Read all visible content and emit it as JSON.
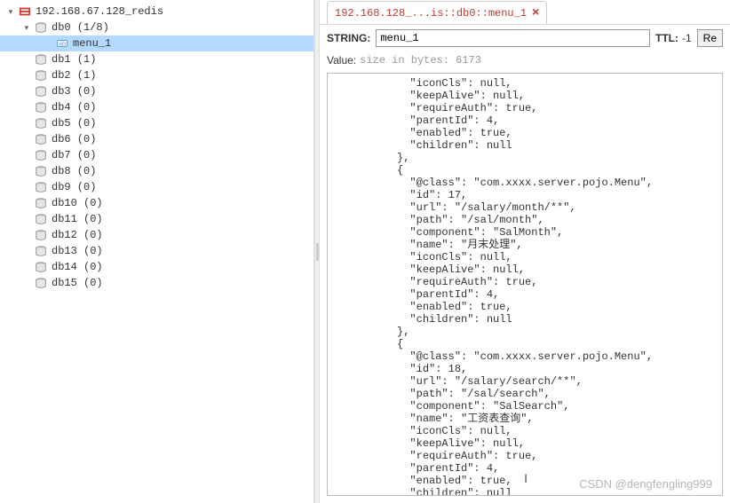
{
  "sidebar": {
    "root": {
      "label": "192.168.67.128_redis"
    },
    "db0": {
      "label": "db0  (1/8)"
    },
    "key": {
      "label": "menu_1"
    },
    "items": [
      {
        "label": "db1  (1)"
      },
      {
        "label": "db2  (1)"
      },
      {
        "label": "db3  (0)"
      },
      {
        "label": "db4  (0)"
      },
      {
        "label": "db5  (0)"
      },
      {
        "label": "db6  (0)"
      },
      {
        "label": "db7  (0)"
      },
      {
        "label": "db8  (0)"
      },
      {
        "label": "db9  (0)"
      },
      {
        "label": "db10  (0)"
      },
      {
        "label": "db11  (0)"
      },
      {
        "label": "db12  (0)"
      },
      {
        "label": "db13  (0)"
      },
      {
        "label": "db14  (0)"
      },
      {
        "label": "db15  (0)"
      }
    ]
  },
  "tab": {
    "label": "192.168.128_...is::db0::menu_1"
  },
  "header": {
    "type_label": "STRING:",
    "key_value": "menu_1",
    "ttl_label": "TTL:",
    "ttl_value": "-1",
    "rename_btn": "Re"
  },
  "value_meta": {
    "label": "Value:",
    "size": "size in bytes: 6173"
  },
  "value_body": "            \"iconCls\": null,\n            \"keepAlive\": null,\n            \"requireAuth\": true,\n            \"parentId\": 4,\n            \"enabled\": true,\n            \"children\": null\n          },\n          {\n            \"@class\": \"com.xxxx.server.pojo.Menu\",\n            \"id\": 17,\n            \"url\": \"/salary/month/**\",\n            \"path\": \"/sal/month\",\n            \"component\": \"SalMonth\",\n            \"name\": \"月末处理\",\n            \"iconCls\": null,\n            \"keepAlive\": null,\n            \"requireAuth\": true,\n            \"parentId\": 4,\n            \"enabled\": true,\n            \"children\": null\n          },\n          {\n            \"@class\": \"com.xxxx.server.pojo.Menu\",\n            \"id\": 18,\n            \"url\": \"/salary/search/**\",\n            \"path\": \"/sal/search\",\n            \"component\": \"SalSearch\",\n            \"name\": \"工资表查询\",\n            \"iconCls\": null,\n            \"keepAlive\": null,\n            \"requireAuth\": true,\n            \"parentId\": 4,\n            \"enabled\": true,\n            \"children\": null\n          }",
  "watermark": "CSDN @dengfengling999"
}
